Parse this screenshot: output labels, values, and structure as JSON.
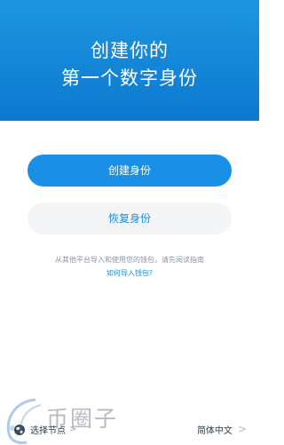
{
  "header": {
    "title_line1": "创建你的",
    "title_line2": "第一个数字身份"
  },
  "actions": {
    "create_label": "创建身份",
    "restore_label": "恢复身份"
  },
  "help": {
    "text": "从其他平台导入和使用您的钱包，请先阅读指南",
    "link": "如何导入钱包?"
  },
  "footer": {
    "node_label": "选择节点",
    "node_arrow": ">",
    "language_label": "简体中文",
    "language_chevron": ">"
  },
  "watermark": {
    "text": "币圈子"
  },
  "icons": {
    "node": "globe-icon",
    "language": "chevron-right-icon"
  },
  "colors": {
    "header_top": "#1f95e0",
    "header_bottom": "#0c78cf",
    "accent": "#1a8fe6",
    "secondary_bg": "#f2f4f6"
  }
}
